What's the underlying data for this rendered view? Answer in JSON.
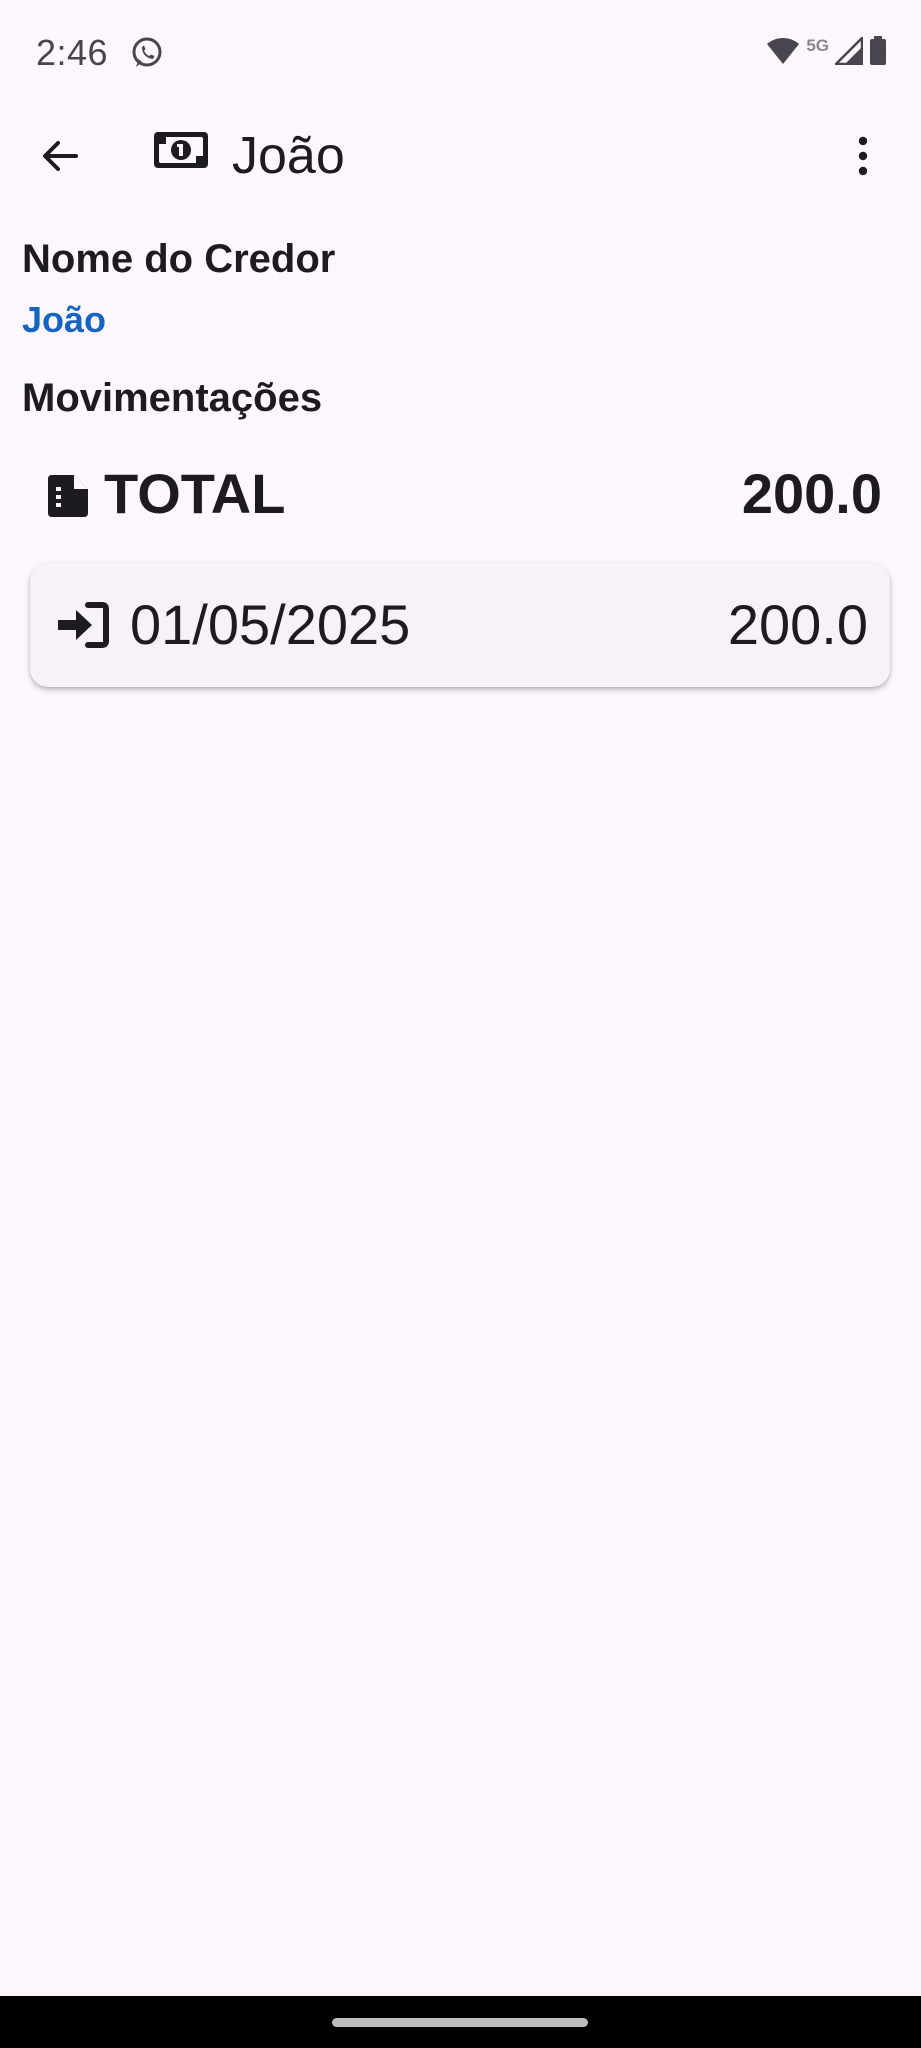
{
  "status_bar": {
    "time": "2:46",
    "network": "5G",
    "icons": [
      "whatsapp-icon",
      "wifi-icon",
      "signal-icon",
      "battery-icon"
    ]
  },
  "app_bar": {
    "title": "João",
    "back_icon": "arrow-back-icon",
    "title_icon": "money-bill-icon",
    "menu_icon": "more-vert-icon"
  },
  "creditor": {
    "label": "Nome do Credor",
    "name": "João"
  },
  "movements": {
    "label": "Movimentações",
    "total_label": "TOTAL",
    "total_value": "200.0",
    "items": [
      {
        "date": "01/05/2025",
        "value": "200.0",
        "icon": "sign-in-icon"
      }
    ]
  },
  "colors": {
    "background": "#fdf7fd",
    "accent": "#1565c0",
    "card": "#f6f2f7",
    "text": "#1d1b20"
  }
}
